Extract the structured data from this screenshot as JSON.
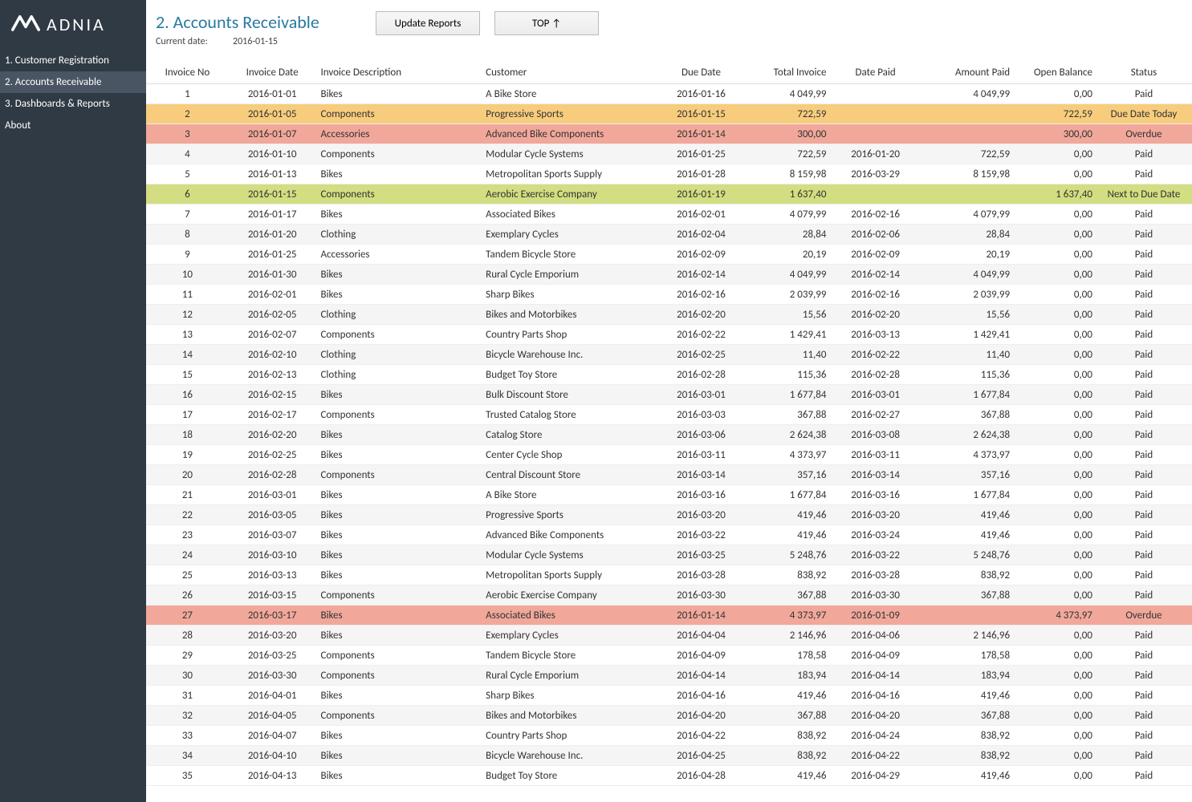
{
  "logo_text": "ADNIA",
  "nav": [
    {
      "label": "1. Customer Registration",
      "active": false
    },
    {
      "label": "2. Accounts Receivable",
      "active": true
    },
    {
      "label": "3. Dashboards & Reports",
      "active": false
    },
    {
      "label": "About",
      "active": false
    }
  ],
  "page_title": "2. Accounts Receivable",
  "current_date_label": "Current date:",
  "current_date_value": "2016-01-15",
  "buttons": {
    "update": "Update Reports",
    "top": "TOP ↑"
  },
  "columns": [
    "Invoice No",
    "Invoice Date",
    "Invoice Description",
    "Customer",
    "Due Date",
    "Total Invoice",
    "Date Paid",
    "Amount Paid",
    "Open Balance",
    "Status"
  ],
  "rows": [
    {
      "no": "1",
      "idate": "2016-01-01",
      "desc": "Bikes",
      "cust": "A Bike Store",
      "due": "2016-01-16",
      "total": "4 049,99",
      "dpaid": "",
      "amt": "4 049,99",
      "bal": "0,00",
      "stat": "Paid",
      "cls": ""
    },
    {
      "no": "2",
      "idate": "2016-01-05",
      "desc": "Components",
      "cust": "Progressive Sports",
      "due": "2016-01-15",
      "total": "722,59",
      "dpaid": "",
      "amt": "",
      "bal": "722,59",
      "stat": "Due Date Today",
      "cls": "due-today"
    },
    {
      "no": "3",
      "idate": "2016-01-07",
      "desc": "Accessories",
      "cust": "Advanced Bike Components",
      "due": "2016-01-14",
      "total": "300,00",
      "dpaid": "",
      "amt": "",
      "bal": "300,00",
      "stat": "Overdue",
      "cls": "overdue"
    },
    {
      "no": "4",
      "idate": "2016-01-10",
      "desc": "Components",
      "cust": "Modular Cycle Systems",
      "due": "2016-01-25",
      "total": "722,59",
      "dpaid": "2016-01-20",
      "amt": "722,59",
      "bal": "0,00",
      "stat": "Paid",
      "cls": ""
    },
    {
      "no": "5",
      "idate": "2016-01-13",
      "desc": "Bikes",
      "cust": "Metropolitan Sports Supply",
      "due": "2016-01-28",
      "total": "8 159,98",
      "dpaid": "2016-03-29",
      "amt": "8 159,98",
      "bal": "0,00",
      "stat": "Paid",
      "cls": ""
    },
    {
      "no": "6",
      "idate": "2016-01-15",
      "desc": "Components",
      "cust": "Aerobic Exercise Company",
      "due": "2016-01-19",
      "total": "1 637,40",
      "dpaid": "",
      "amt": "",
      "bal": "1 637,40",
      "stat": "Next to Due Date",
      "cls": "next-due"
    },
    {
      "no": "7",
      "idate": "2016-01-17",
      "desc": "Bikes",
      "cust": "Associated Bikes",
      "due": "2016-02-01",
      "total": "4 079,99",
      "dpaid": "2016-02-16",
      "amt": "4 079,99",
      "bal": "0,00",
      "stat": "Paid",
      "cls": ""
    },
    {
      "no": "8",
      "idate": "2016-01-20",
      "desc": "Clothing",
      "cust": "Exemplary Cycles",
      "due": "2016-02-04",
      "total": "28,84",
      "dpaid": "2016-02-06",
      "amt": "28,84",
      "bal": "0,00",
      "stat": "Paid",
      "cls": ""
    },
    {
      "no": "9",
      "idate": "2016-01-25",
      "desc": "Accessories",
      "cust": "Tandem Bicycle Store",
      "due": "2016-02-09",
      "total": "20,19",
      "dpaid": "2016-02-09",
      "amt": "20,19",
      "bal": "0,00",
      "stat": "Paid",
      "cls": ""
    },
    {
      "no": "10",
      "idate": "2016-01-30",
      "desc": "Bikes",
      "cust": "Rural Cycle Emporium",
      "due": "2016-02-14",
      "total": "4 049,99",
      "dpaid": "2016-02-14",
      "amt": "4 049,99",
      "bal": "0,00",
      "stat": "Paid",
      "cls": ""
    },
    {
      "no": "11",
      "idate": "2016-02-01",
      "desc": "Bikes",
      "cust": "Sharp Bikes",
      "due": "2016-02-16",
      "total": "2 039,99",
      "dpaid": "2016-02-16",
      "amt": "2 039,99",
      "bal": "0,00",
      "stat": "Paid",
      "cls": ""
    },
    {
      "no": "12",
      "idate": "2016-02-05",
      "desc": "Clothing",
      "cust": "Bikes and Motorbikes",
      "due": "2016-02-20",
      "total": "15,56",
      "dpaid": "2016-02-20",
      "amt": "15,56",
      "bal": "0,00",
      "stat": "Paid",
      "cls": ""
    },
    {
      "no": "13",
      "idate": "2016-02-07",
      "desc": "Components",
      "cust": "Country Parts Shop",
      "due": "2016-02-22",
      "total": "1 429,41",
      "dpaid": "2016-03-13",
      "amt": "1 429,41",
      "bal": "0,00",
      "stat": "Paid",
      "cls": ""
    },
    {
      "no": "14",
      "idate": "2016-02-10",
      "desc": "Clothing",
      "cust": "Bicycle Warehouse Inc.",
      "due": "2016-02-25",
      "total": "11,40",
      "dpaid": "2016-02-22",
      "amt": "11,40",
      "bal": "0,00",
      "stat": "Paid",
      "cls": ""
    },
    {
      "no": "15",
      "idate": "2016-02-13",
      "desc": "Clothing",
      "cust": "Budget Toy Store",
      "due": "2016-02-28",
      "total": "115,36",
      "dpaid": "2016-02-28",
      "amt": "115,36",
      "bal": "0,00",
      "stat": "Paid",
      "cls": ""
    },
    {
      "no": "16",
      "idate": "2016-02-15",
      "desc": "Bikes",
      "cust": "Bulk Discount Store",
      "due": "2016-03-01",
      "total": "1 677,84",
      "dpaid": "2016-03-01",
      "amt": "1 677,84",
      "bal": "0,00",
      "stat": "Paid",
      "cls": ""
    },
    {
      "no": "17",
      "idate": "2016-02-17",
      "desc": "Components",
      "cust": "Trusted Catalog Store",
      "due": "2016-03-03",
      "total": "367,88",
      "dpaid": "2016-02-27",
      "amt": "367,88",
      "bal": "0,00",
      "stat": "Paid",
      "cls": ""
    },
    {
      "no": "18",
      "idate": "2016-02-20",
      "desc": "Bikes",
      "cust": "Catalog Store",
      "due": "2016-03-06",
      "total": "2 624,38",
      "dpaid": "2016-03-08",
      "amt": "2 624,38",
      "bal": "0,00",
      "stat": "Paid",
      "cls": ""
    },
    {
      "no": "19",
      "idate": "2016-02-25",
      "desc": "Bikes",
      "cust": "Center Cycle Shop",
      "due": "2016-03-11",
      "total": "4 373,97",
      "dpaid": "2016-03-11",
      "amt": "4 373,97",
      "bal": "0,00",
      "stat": "Paid",
      "cls": ""
    },
    {
      "no": "20",
      "idate": "2016-02-28",
      "desc": "Components",
      "cust": "Central Discount Store",
      "due": "2016-03-14",
      "total": "357,16",
      "dpaid": "2016-03-14",
      "amt": "357,16",
      "bal": "0,00",
      "stat": "Paid",
      "cls": ""
    },
    {
      "no": "21",
      "idate": "2016-03-01",
      "desc": "Bikes",
      "cust": "A Bike Store",
      "due": "2016-03-16",
      "total": "1 677,84",
      "dpaid": "2016-03-16",
      "amt": "1 677,84",
      "bal": "0,00",
      "stat": "Paid",
      "cls": ""
    },
    {
      "no": "22",
      "idate": "2016-03-05",
      "desc": "Bikes",
      "cust": "Progressive Sports",
      "due": "2016-03-20",
      "total": "419,46",
      "dpaid": "2016-03-20",
      "amt": "419,46",
      "bal": "0,00",
      "stat": "Paid",
      "cls": ""
    },
    {
      "no": "23",
      "idate": "2016-03-07",
      "desc": "Bikes",
      "cust": "Advanced Bike Components",
      "due": "2016-03-22",
      "total": "419,46",
      "dpaid": "2016-03-24",
      "amt": "419,46",
      "bal": "0,00",
      "stat": "Paid",
      "cls": ""
    },
    {
      "no": "24",
      "idate": "2016-03-10",
      "desc": "Bikes",
      "cust": "Modular Cycle Systems",
      "due": "2016-03-25",
      "total": "5 248,76",
      "dpaid": "2016-03-22",
      "amt": "5 248,76",
      "bal": "0,00",
      "stat": "Paid",
      "cls": ""
    },
    {
      "no": "25",
      "idate": "2016-03-13",
      "desc": "Bikes",
      "cust": "Metropolitan Sports Supply",
      "due": "2016-03-28",
      "total": "838,92",
      "dpaid": "2016-03-28",
      "amt": "838,92",
      "bal": "0,00",
      "stat": "Paid",
      "cls": ""
    },
    {
      "no": "26",
      "idate": "2016-03-15",
      "desc": "Components",
      "cust": "Aerobic Exercise Company",
      "due": "2016-03-30",
      "total": "367,88",
      "dpaid": "2016-03-30",
      "amt": "367,88",
      "bal": "0,00",
      "stat": "Paid",
      "cls": ""
    },
    {
      "no": "27",
      "idate": "2016-03-17",
      "desc": "Bikes",
      "cust": "Associated Bikes",
      "due": "2016-01-14",
      "total": "4 373,97",
      "dpaid": "2016-01-09",
      "amt": "",
      "bal": "4 373,97",
      "stat": "Overdue",
      "cls": "overdue"
    },
    {
      "no": "28",
      "idate": "2016-03-20",
      "desc": "Bikes",
      "cust": "Exemplary Cycles",
      "due": "2016-04-04",
      "total": "2 146,96",
      "dpaid": "2016-04-06",
      "amt": "2 146,96",
      "bal": "0,00",
      "stat": "Paid",
      "cls": ""
    },
    {
      "no": "29",
      "idate": "2016-03-25",
      "desc": "Components",
      "cust": "Tandem Bicycle Store",
      "due": "2016-04-09",
      "total": "178,58",
      "dpaid": "2016-04-09",
      "amt": "178,58",
      "bal": "0,00",
      "stat": "Paid",
      "cls": ""
    },
    {
      "no": "30",
      "idate": "2016-03-30",
      "desc": "Components",
      "cust": "Rural Cycle Emporium",
      "due": "2016-04-14",
      "total": "183,94",
      "dpaid": "2016-04-14",
      "amt": "183,94",
      "bal": "0,00",
      "stat": "Paid",
      "cls": ""
    },
    {
      "no": "31",
      "idate": "2016-04-01",
      "desc": "Bikes",
      "cust": "Sharp Bikes",
      "due": "2016-04-16",
      "total": "419,46",
      "dpaid": "2016-04-16",
      "amt": "419,46",
      "bal": "0,00",
      "stat": "Paid",
      "cls": ""
    },
    {
      "no": "32",
      "idate": "2016-04-05",
      "desc": "Components",
      "cust": "Bikes and Motorbikes",
      "due": "2016-04-20",
      "total": "367,88",
      "dpaid": "2016-04-20",
      "amt": "367,88",
      "bal": "0,00",
      "stat": "Paid",
      "cls": ""
    },
    {
      "no": "33",
      "idate": "2016-04-07",
      "desc": "Bikes",
      "cust": "Country Parts Shop",
      "due": "2016-04-22",
      "total": "838,92",
      "dpaid": "2016-04-24",
      "amt": "838,92",
      "bal": "0,00",
      "stat": "Paid",
      "cls": ""
    },
    {
      "no": "34",
      "idate": "2016-04-10",
      "desc": "Bikes",
      "cust": "Bicycle Warehouse Inc.",
      "due": "2016-04-25",
      "total": "838,92",
      "dpaid": "2016-04-22",
      "amt": "838,92",
      "bal": "0,00",
      "stat": "Paid",
      "cls": ""
    },
    {
      "no": "35",
      "idate": "2016-04-13",
      "desc": "Bikes",
      "cust": "Budget Toy Store",
      "due": "2016-04-28",
      "total": "419,46",
      "dpaid": "2016-04-29",
      "amt": "419,46",
      "bal": "0,00",
      "stat": "Paid",
      "cls": ""
    }
  ]
}
